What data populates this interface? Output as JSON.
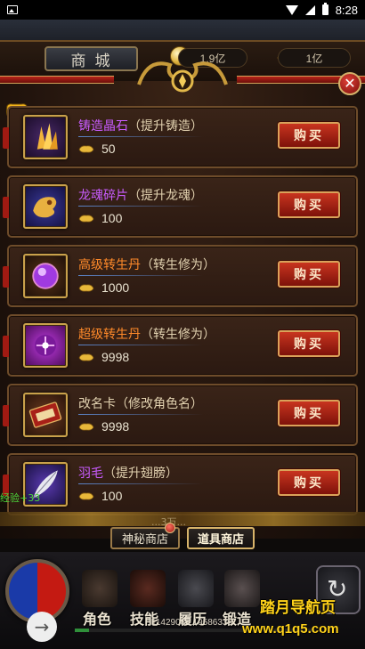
{
  "status_bar": {
    "time": "8:28"
  },
  "shop": {
    "title": "商城",
    "currency": [
      {
        "icon": "gold-coin-icon",
        "value": "1.9亿"
      },
      {
        "icon": "gold-ingot-icon",
        "value": "1亿"
      }
    ],
    "buy_label": "购买",
    "items": [
      {
        "name": "铸造晶石",
        "desc": "（提升铸造）",
        "price": "50",
        "color": "purple",
        "icon": "crystal-icon"
      },
      {
        "name": "龙魂碎片",
        "desc": "（提升龙魂）",
        "price": "100",
        "color": "purple",
        "icon": "dragon-soul-icon"
      },
      {
        "name": "高级转生丹",
        "desc": "（转生修为）",
        "price": "1000",
        "color": "orange",
        "icon": "purple-pill-icon"
      },
      {
        "name": "超级转生丹",
        "desc": "（转生修为）",
        "price": "9998",
        "color": "orange",
        "icon": "super-pill-icon"
      },
      {
        "name": "改名卡",
        "desc": "（修改角色名）",
        "price": "9998",
        "color": "white",
        "icon": "rename-card-icon"
      },
      {
        "name": "羽毛",
        "desc": "（提升翅膀）",
        "price": "100",
        "color": "purple",
        "icon": "feather-icon"
      }
    ],
    "tabs": {
      "mystery": "神秘商店",
      "props": "道具商店"
    },
    "partial_text": "...3万..."
  },
  "hud": {
    "exp_label": "经验+33",
    "buttons": {
      "role": "角色",
      "skill": "技能",
      "resume": "履历",
      "forge": "锻造"
    },
    "exp_values": "1142908 / 19586336"
  },
  "watermark": {
    "cn": "踏月导航页",
    "url": "www.q1q5.com"
  }
}
